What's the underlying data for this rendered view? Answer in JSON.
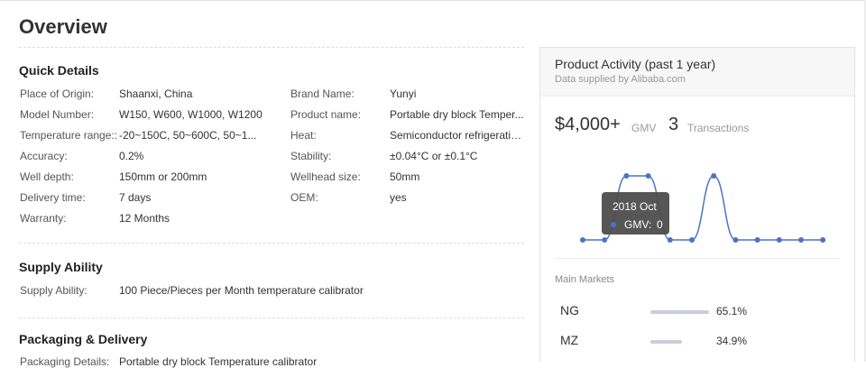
{
  "overview": {
    "title": "Overview"
  },
  "quick_details": {
    "title": "Quick Details",
    "left": [
      {
        "label": "Place of Origin:",
        "value": "Shaanxi, China"
      },
      {
        "label": "Model Number:",
        "value": "W150, W600, W1000, W1200"
      },
      {
        "label": "Temperature range::",
        "value": "-20~150C, 50~600C, 50~1..."
      },
      {
        "label": "Accuracy:",
        "value": "0.2%"
      },
      {
        "label": "Well depth:",
        "value": "150mm or 200mm"
      },
      {
        "label": "Delivery time:",
        "value": "7 days"
      },
      {
        "label": "Warranty:",
        "value": "12 Months"
      }
    ],
    "right": [
      {
        "label": "Brand Name:",
        "value": "Yunyi"
      },
      {
        "label": "Product name:",
        "value": "Portable dry block Temper..."
      },
      {
        "label": "Heat:",
        "value": "Semiconductor refrigeratio..."
      },
      {
        "label": "Stability:",
        "value": "±0.04°C or ±0.1°C"
      },
      {
        "label": "Wellhead size:",
        "value": "50mm"
      },
      {
        "label": "OEM:",
        "value": "yes"
      }
    ]
  },
  "supply_ability": {
    "title": "Supply Ability",
    "label": "Supply Ability:",
    "value": "100 Piece/Pieces per Month temperature calibrator"
  },
  "packaging": {
    "title": "Packaging & Delivery",
    "label": "Packaging Details:",
    "value": "Portable dry block Temperature calibrator"
  },
  "activity": {
    "title": "Product Activity (past 1 year)",
    "subtitle": "Data supplied by Alibaba.com",
    "gmv_value": "$4,000+",
    "gmv_label": "GMV",
    "transactions_value": "3",
    "transactions_label": "Transactions",
    "tooltip": {
      "period": "2018 Oct",
      "label": "GMV:",
      "value": "0"
    },
    "accent_color": "#4a73c6"
  },
  "chart_data": {
    "type": "line",
    "series": [
      {
        "values": [
          0,
          0,
          1,
          1,
          0,
          0,
          1,
          0,
          0,
          0,
          0,
          0
        ]
      }
    ],
    "highlight_index": 1,
    "grid": false
  },
  "main_markets": {
    "title": "Main Markets",
    "items": [
      {
        "name": "NG",
        "percent": "65.1%",
        "share": 0.651
      },
      {
        "name": "MZ",
        "percent": "34.9%",
        "share": 0.349
      }
    ]
  }
}
